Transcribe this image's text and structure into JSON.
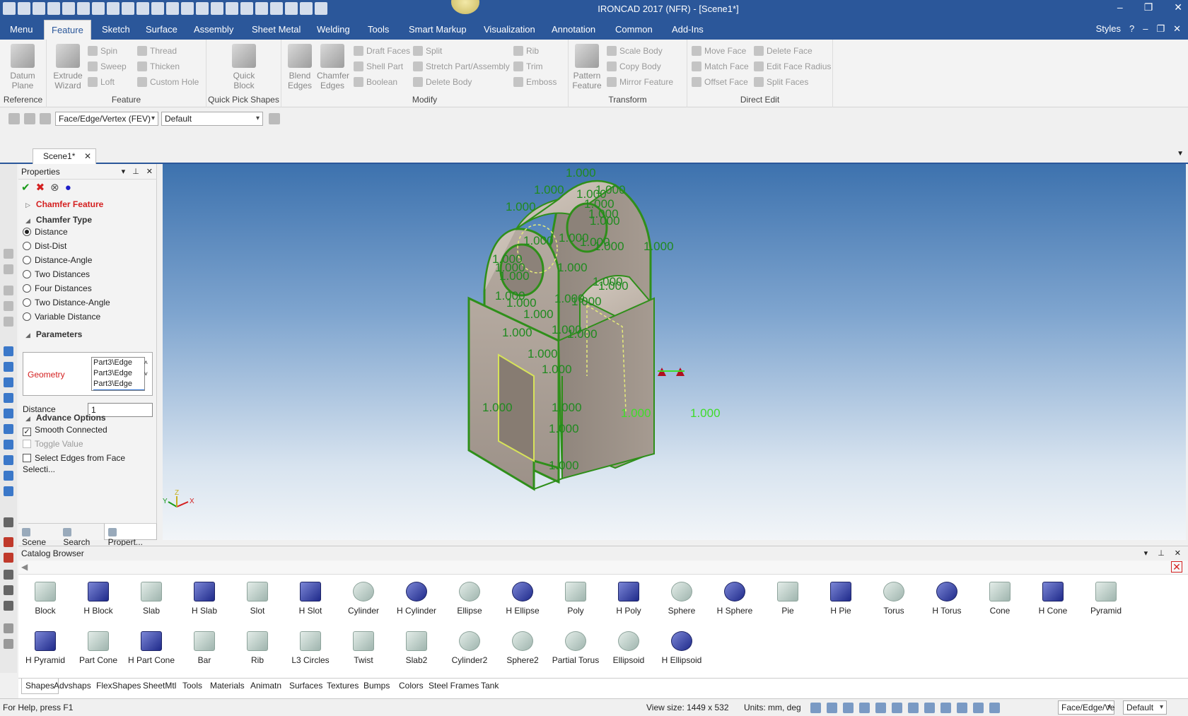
{
  "window": {
    "title": "IRONCAD 2017 (NFR) - [Scene1*]",
    "controls": [
      "–",
      "❐",
      "✕"
    ]
  },
  "menubar": {
    "tabs": [
      "Menu",
      "Feature",
      "Sketch",
      "Surface",
      "Assembly",
      "Sheet Metal",
      "Welding",
      "Tools",
      "Smart Markup",
      "Visualization",
      "Annotation",
      "Common",
      "Add-Ins"
    ],
    "active": "Feature",
    "styles_label": "Styles",
    "help": "?"
  },
  "ribbon": {
    "reference": {
      "label": "Reference",
      "datum_plane": "Datum Plane"
    },
    "feature": {
      "label": "Feature",
      "extrude_wizard": "Extrude Wizard",
      "spin": "Spin",
      "sweep": "Sweep",
      "loft": "Loft",
      "thread": "Thread",
      "thicken": "Thicken",
      "custom_hole": "Custom Hole"
    },
    "quick_pick": {
      "label": "Quick Pick Shapes",
      "quick_block": "Quick Block"
    },
    "modify": {
      "label": "Modify",
      "blend_edges": "Blend Edges",
      "chamfer_edges": "Chamfer Edges",
      "draft_faces": "Draft Faces",
      "shell_part": "Shell Part",
      "boolean": "Boolean",
      "split": "Split",
      "stretch": "Stretch Part/Assembly",
      "delete_body": "Delete Body",
      "rib": "Rib",
      "trim": "Trim",
      "emboss": "Emboss"
    },
    "transform": {
      "label": "Transform",
      "pattern_feature": "Pattern Feature",
      "scale_body": "Scale Body",
      "copy_body": "Copy Body",
      "mirror_feature": "Mirror Feature"
    },
    "direct_edit": {
      "label": "Direct Edit",
      "move_face": "Move Face",
      "match_face": "Match Face",
      "offset_face": "Offset Face",
      "delete_face": "Delete Face",
      "edit_face_radius": "Edit Face Radius",
      "split_faces": "Split Faces"
    }
  },
  "selection": {
    "filter": "Face/Edge/Vertex (FEV)",
    "style": "Default"
  },
  "doc_tab": {
    "name": "Scene1*"
  },
  "properties": {
    "title": "Properties",
    "feature_name": "Chamfer Feature",
    "chamfer_type_header": "Chamfer Type",
    "types": [
      "Distance",
      "Dist-Dist",
      "Distance-Angle",
      "Two Distances",
      "Four Distances",
      "Two Distance-Angle",
      "Variable Distance"
    ],
    "selected_type": 0,
    "parameters_header": "Parameters",
    "geometry_label": "Geometry",
    "geometry_items": [
      "Part3\\Edge",
      "Part3\\Edge",
      "Part3\\Edge"
    ],
    "distance_label": "Distance",
    "distance_value": "1",
    "advance_header": "Advance Options",
    "smooth_connected": "Smooth Connected",
    "toggle_value": "Toggle Value",
    "select_edges": "Select Edges from Face Selecti...",
    "tabs": [
      "Scene",
      "Search",
      "Propert..."
    ]
  },
  "viewport": {
    "dimension_label": "1.000",
    "axis_x": "X",
    "axis_y": "Y",
    "axis_z": "Z"
  },
  "catalog": {
    "title": "Catalog Browser",
    "row1": [
      "Block",
      "H Block",
      "Slab",
      "H Slab",
      "Slot",
      "H Slot",
      "Cylinder",
      "H Cylinder",
      "Ellipse",
      "H Ellipse",
      "Poly",
      "H Poly",
      "Sphere",
      "H Sphere",
      "Pie",
      "H Pie",
      "Torus",
      "H Torus",
      "Cone",
      "H Cone",
      "Pyramid"
    ],
    "row2": [
      "H Pyramid",
      "Part Cone",
      "H Part Cone",
      "Bar",
      "Rib",
      "L3 Circles",
      "Twist",
      "Slab2",
      "Cylinder2",
      "Sphere2",
      "Partial Torus",
      "Ellipsoid",
      "H Ellipsoid"
    ],
    "tabs": [
      "Shapes",
      "Advshaps",
      "FlexShapes",
      "SheetMtl",
      "Tools",
      "Materials",
      "Animatn",
      "Surfaces",
      "Textures",
      "Bumps",
      "Colors",
      "Steel Frames",
      "Tank"
    ]
  },
  "status": {
    "help": "For Help, press F1",
    "view_size": "View size: 1449 x  532",
    "units": "Units: mm, deg",
    "filter": "Face/Edge/Ve",
    "style": "Default"
  }
}
